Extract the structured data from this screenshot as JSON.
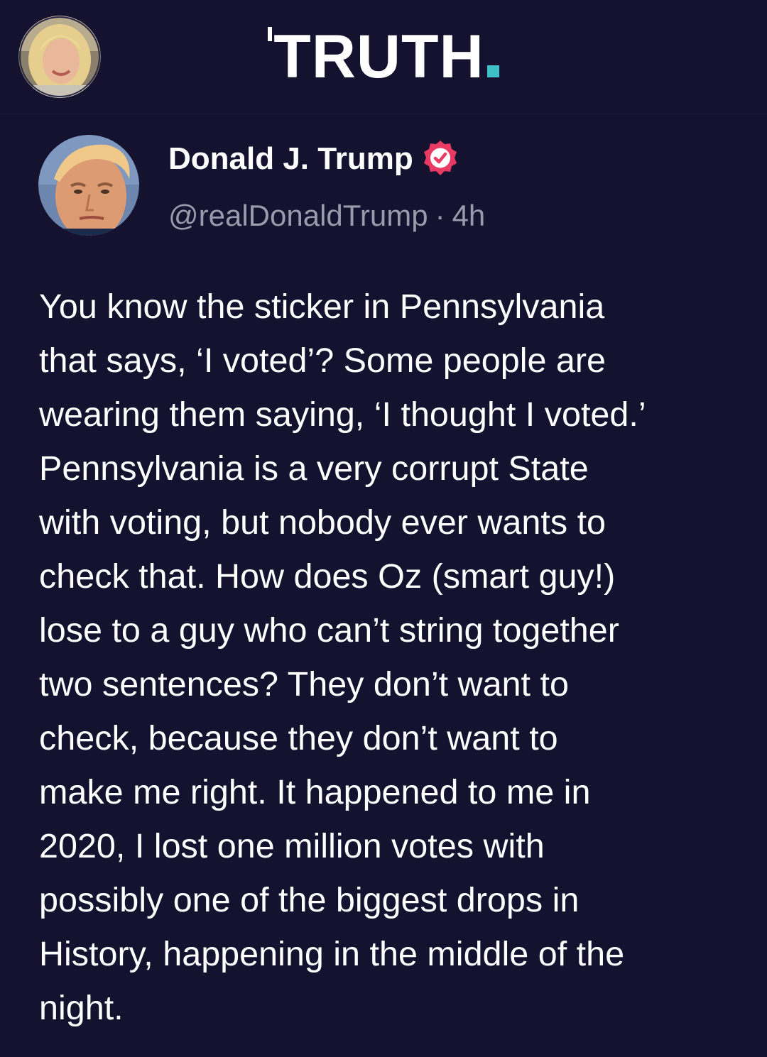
{
  "header": {
    "logo_text": "TRUTH",
    "accent_color": "#3dc1c6"
  },
  "post": {
    "author_name": "Donald J. Trump",
    "verified_icon": "verified-badge-icon",
    "handle": "@realDonaldTrump",
    "separator": "·",
    "time_ago": "4h",
    "body_lines": [
      "You know the sticker in Pennsylvania",
      "that says, ‘I voted’? Some people are",
      "wearing them saying, ‘I thought I voted.’",
      "Pennsylvania is a very corrupt State",
      "with voting, but nobody ever wants to",
      "check that. How does Oz (smart guy!)",
      "lose to a guy who can’t string together",
      "two sentences? They don’t want to",
      "check, because they don’t want to",
      "make me right. It happened to me in",
      "2020, I lost one million votes with",
      "possibly one of the biggest drops in",
      "History, happening in the middle of the",
      "night."
    ]
  },
  "colors": {
    "background": "#14122f",
    "verified_badge": "#e83a63",
    "secondary_text": "#9a9aac"
  }
}
